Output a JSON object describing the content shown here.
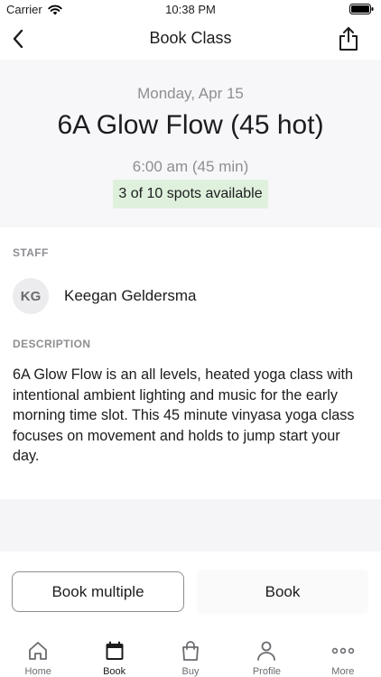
{
  "status_bar": {
    "carrier": "Carrier",
    "time": "10:38 PM"
  },
  "nav": {
    "title": "Book Class"
  },
  "class": {
    "date": "Monday, Apr 15",
    "name": "6A Glow Flow (45 hot)",
    "time": "6:00 am (45 min)",
    "spots": "3 of 10 spots available"
  },
  "staff": {
    "label": "STAFF",
    "initials": "KG",
    "name": "Keegan Geldersma"
  },
  "description": {
    "label": "DESCRIPTION",
    "text": "6A Glow Flow is an all levels, heated yoga class with intentional ambient lighting and music for the early morning time slot. This 45 minute vinyasa yoga class focuses on movement and holds to jump start your day."
  },
  "actions": {
    "book_multiple": "Book multiple",
    "book": "Book"
  },
  "tabs": [
    {
      "label": "Home",
      "icon": "home-icon"
    },
    {
      "label": "Book",
      "icon": "calendar-icon"
    },
    {
      "label": "Buy",
      "icon": "shopping-bag-icon"
    },
    {
      "label": "Profile",
      "icon": "person-icon"
    },
    {
      "label": "More",
      "icon": "more-dots-icon"
    }
  ],
  "colors": {
    "spots_badge_bg": "#dff1dc",
    "header_bg": "#f7f7f9",
    "muted_text": "#8e8e93"
  }
}
